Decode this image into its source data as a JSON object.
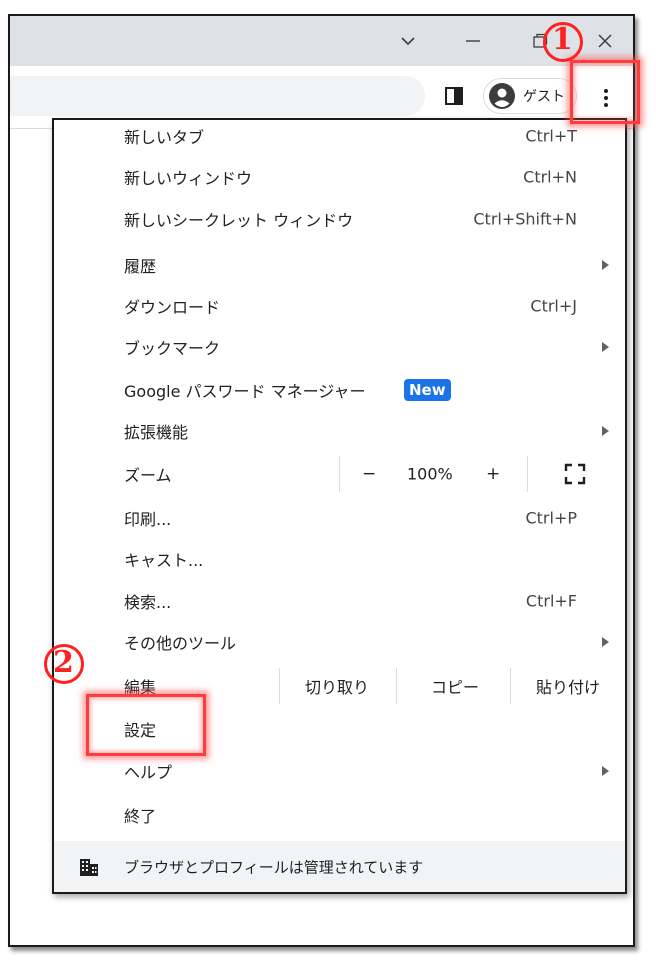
{
  "window_controls": {
    "tabs_dropdown_glyph": "⌄",
    "minimize_glyph": "—",
    "maximize_glyph": "□",
    "close_glyph": "✕"
  },
  "toolbar": {
    "profile_name": "ゲスト"
  },
  "menu": {
    "items": [
      {
        "label": "新しいタブ",
        "shortcut": "Ctrl+T"
      },
      {
        "label": "新しいウィンドウ",
        "shortcut": "Ctrl+N"
      },
      {
        "label": "新しいシークレット ウィンドウ",
        "shortcut": "Ctrl+Shift+N"
      },
      {
        "label": "履歴",
        "shortcut": ""
      },
      {
        "label": "ダウンロード",
        "shortcut": "Ctrl+J"
      },
      {
        "label": "ブックマーク",
        "shortcut": ""
      },
      {
        "label": "Google パスワード マネージャー",
        "badge": "New"
      },
      {
        "label": "拡張機能",
        "shortcut": ""
      }
    ],
    "zoom": {
      "label": "ズーム",
      "minus": "−",
      "value": "100%",
      "plus": "+"
    },
    "items2": [
      {
        "label": "印刷...",
        "shortcut": "Ctrl+P"
      },
      {
        "label": "キャスト...",
        "shortcut": ""
      },
      {
        "label": "検索...",
        "shortcut": "Ctrl+F"
      },
      {
        "label": "その他のツール",
        "shortcut": ""
      }
    ],
    "edit": {
      "label": "編集",
      "cut": "切り取り",
      "copy": "コピー",
      "paste": "貼り付け"
    },
    "items3": [
      {
        "label": "設定"
      },
      {
        "label": "ヘルプ"
      },
      {
        "label": "終了"
      }
    ],
    "footer": {
      "text": "ブラウザとプロフィールは管理されています"
    }
  },
  "annotations": {
    "step1": "1",
    "step2": "2",
    "highlight_color": "#ff3b3b"
  }
}
